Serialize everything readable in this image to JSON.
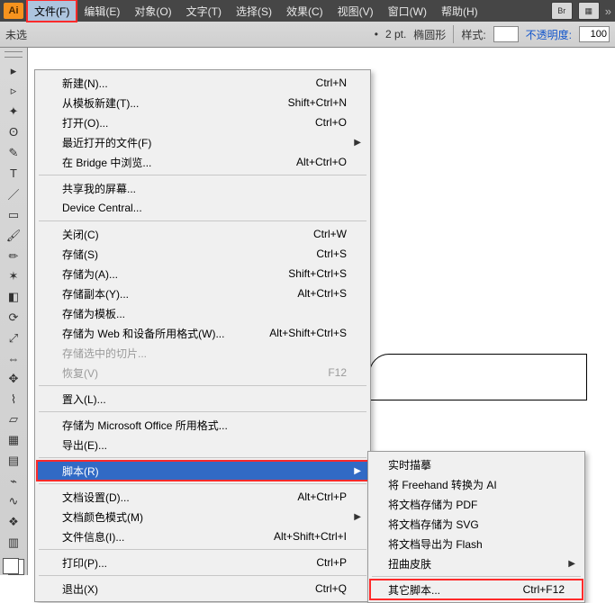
{
  "app": {
    "logo_text": "Ai"
  },
  "menubar": [
    {
      "label": "文件(F)",
      "id": "file",
      "active": true
    },
    {
      "label": "编辑(E)",
      "id": "edit"
    },
    {
      "label": "对象(O)",
      "id": "object"
    },
    {
      "label": "文字(T)",
      "id": "type"
    },
    {
      "label": "选择(S)",
      "id": "select"
    },
    {
      "label": "效果(C)",
      "id": "effect"
    },
    {
      "label": "视图(V)",
      "id": "view"
    },
    {
      "label": "窗口(W)",
      "id": "window"
    },
    {
      "label": "帮助(H)",
      "id": "help"
    }
  ],
  "header_buttons": [
    {
      "id": "br",
      "label": "Br"
    },
    {
      "id": "grid",
      "label": "▦"
    }
  ],
  "toolbar": {
    "left_label": "未选",
    "dot": "•",
    "stroke_value": "2 pt.",
    "stroke_label": "椭圆形",
    "style_label": "样式:",
    "opacity_label": "不透明度:",
    "opacity_value": "100"
  },
  "file_menu": [
    {
      "label": "新建(N)...",
      "shortcut": "Ctrl+N"
    },
    {
      "label": "从模板新建(T)...",
      "shortcut": "Shift+Ctrl+N"
    },
    {
      "label": "打开(O)...",
      "shortcut": "Ctrl+O"
    },
    {
      "label": "最近打开的文件(F)",
      "submenu": true
    },
    {
      "label": "在 Bridge 中浏览...",
      "shortcut": "Alt+Ctrl+O"
    },
    {
      "sep": true
    },
    {
      "label": "共享我的屏幕..."
    },
    {
      "label": "Device Central..."
    },
    {
      "sep": true
    },
    {
      "label": "关闭(C)",
      "shortcut": "Ctrl+W"
    },
    {
      "label": "存储(S)",
      "shortcut": "Ctrl+S"
    },
    {
      "label": "存储为(A)...",
      "shortcut": "Shift+Ctrl+S"
    },
    {
      "label": "存储副本(Y)...",
      "shortcut": "Alt+Ctrl+S"
    },
    {
      "label": "存储为模板..."
    },
    {
      "label": "存储为 Web 和设备所用格式(W)...",
      "shortcut": "Alt+Shift+Ctrl+S"
    },
    {
      "label": "存储选中的切片...",
      "disabled": true
    },
    {
      "label": "恢复(V)",
      "shortcut": "F12",
      "disabled": true
    },
    {
      "sep": true
    },
    {
      "label": "置入(L)..."
    },
    {
      "sep": true
    },
    {
      "label": "存储为 Microsoft Office 所用格式..."
    },
    {
      "label": "导出(E)..."
    },
    {
      "sep": true
    },
    {
      "label": "脚本(R)",
      "submenu": true,
      "highlight": true,
      "hover": true
    },
    {
      "sep": true
    },
    {
      "label": "文档设置(D)...",
      "shortcut": "Alt+Ctrl+P"
    },
    {
      "label": "文档颜色模式(M)",
      "submenu": true
    },
    {
      "label": "文件信息(I)...",
      "shortcut": "Alt+Shift+Ctrl+I"
    },
    {
      "sep": true
    },
    {
      "label": "打印(P)...",
      "shortcut": "Ctrl+P"
    },
    {
      "sep": true
    },
    {
      "label": "退出(X)",
      "shortcut": "Ctrl+Q"
    }
  ],
  "script_submenu": [
    {
      "label": "实时描摹"
    },
    {
      "label": "将 Freehand 转换为 AI"
    },
    {
      "label": "将文档存储为 PDF"
    },
    {
      "label": "将文档存储为 SVG"
    },
    {
      "label": "将文档导出为 Flash"
    },
    {
      "label": "扭曲皮肤",
      "submenu": true
    },
    {
      "sep": true
    },
    {
      "label": "其它脚本...",
      "shortcut": "Ctrl+F12",
      "highlight": true
    }
  ],
  "tools": [
    "sel",
    "direct",
    "wand",
    "lasso",
    "pen",
    "type",
    "line",
    "rect",
    "brush",
    "pencil",
    "blob",
    "eraser",
    "rotate",
    "scale",
    "width",
    "free",
    "shape",
    "perspective",
    "mesh",
    "gradient",
    "eyedrop",
    "blend",
    "symbol",
    "graph"
  ],
  "tool_glyphs": {
    "sel": "▸",
    "direct": "▹",
    "wand": "✦",
    "lasso": "ʘ",
    "pen": "✎",
    "type": "T",
    "line": "／",
    "rect": "▭",
    "brush": "🖌",
    "pencil": "✏",
    "blob": "✶",
    "eraser": "◧",
    "rotate": "⟳",
    "scale": "⤢",
    "width": "⇔",
    "free": "✥",
    "shape": "⌇",
    "perspective": "▱",
    "mesh": "▦",
    "gradient": "▤",
    "eyedrop": "⌁",
    "blend": "∿",
    "symbol": "❖",
    "graph": "▥"
  }
}
